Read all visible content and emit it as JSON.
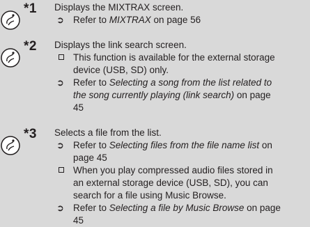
{
  "entries": [
    {
      "marker": "*1",
      "title": "Displays the MIXTRAX screen.",
      "items": [
        {
          "type": "arrow",
          "prefix": "Refer to ",
          "italic": "MIXTRAX",
          "suffix": " on page 56"
        }
      ]
    },
    {
      "marker": "*2",
      "title": "Displays the link search screen.",
      "items": [
        {
          "type": "box",
          "line1": "This function is available for the external storage",
          "line2": "device (USB, SD) only."
        },
        {
          "type": "arrow",
          "prefix": "Refer to ",
          "italic1": "Selecting a song from the list related to",
          "italic2": "the song currently playing (link search)",
          "suffix": " on page",
          "line3": "45"
        }
      ]
    },
    {
      "marker": "*3",
      "title": "Selects a file from the list.",
      "items": [
        {
          "type": "arrow",
          "prefix": "Refer to ",
          "italic": "Selecting files from the file name list",
          "suffix": " on",
          "line2": "page 45"
        },
        {
          "type": "box",
          "line1": "When you play compressed audio files stored in",
          "line2": "an external storage device (USB, SD), you can",
          "line3": "search for a file using Music Browse."
        },
        {
          "type": "arrow",
          "prefix": "Refer to ",
          "italic": "Selecting a file by Music Browse",
          "suffix": " on page",
          "line2": "45"
        }
      ]
    }
  ],
  "icon": "touch-key-icon",
  "colors": {
    "background": "#d9d9d9",
    "text": "#231f20"
  }
}
